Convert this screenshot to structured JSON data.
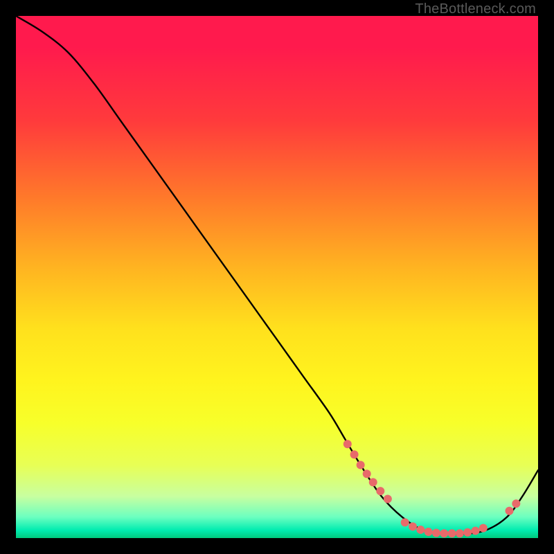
{
  "attribution": "TheBottleneck.com",
  "chart_data": {
    "type": "line",
    "title": "",
    "xlabel": "",
    "ylabel": "",
    "xlim": [
      0,
      100
    ],
    "ylim": [
      0,
      100
    ],
    "grid": false,
    "series": [
      {
        "name": "curve",
        "color": "#000000",
        "x": [
          0,
          5,
          10,
          15,
          20,
          25,
          30,
          35,
          40,
          45,
          50,
          55,
          60,
          63,
          66,
          70,
          74,
          78,
          82,
          86,
          90,
          94,
          97,
          100
        ],
        "y": [
          100,
          97,
          93,
          87,
          80,
          73,
          66,
          59,
          52,
          45,
          38,
          31,
          24,
          19,
          14,
          8,
          4,
          1.5,
          0.8,
          0.8,
          1.5,
          4,
          8,
          13
        ]
      }
    ],
    "markers": {
      "name": "highlight-points",
      "color": "#e86a6a",
      "radius_px": 6,
      "x": [
        63.5,
        64.8,
        66.0,
        67.2,
        68.4,
        69.8,
        71.2,
        74.5,
        76.0,
        77.5,
        79.0,
        80.5,
        82.0,
        83.5,
        85.0,
        86.5,
        88.0,
        89.5,
        94.5,
        95.8
      ],
      "y": [
        18.0,
        16.0,
        14.0,
        12.3,
        10.7,
        9.0,
        7.5,
        3.0,
        2.2,
        1.6,
        1.2,
        1.0,
        0.9,
        0.9,
        0.9,
        1.1,
        1.4,
        1.9,
        5.2,
        6.6
      ]
    }
  }
}
